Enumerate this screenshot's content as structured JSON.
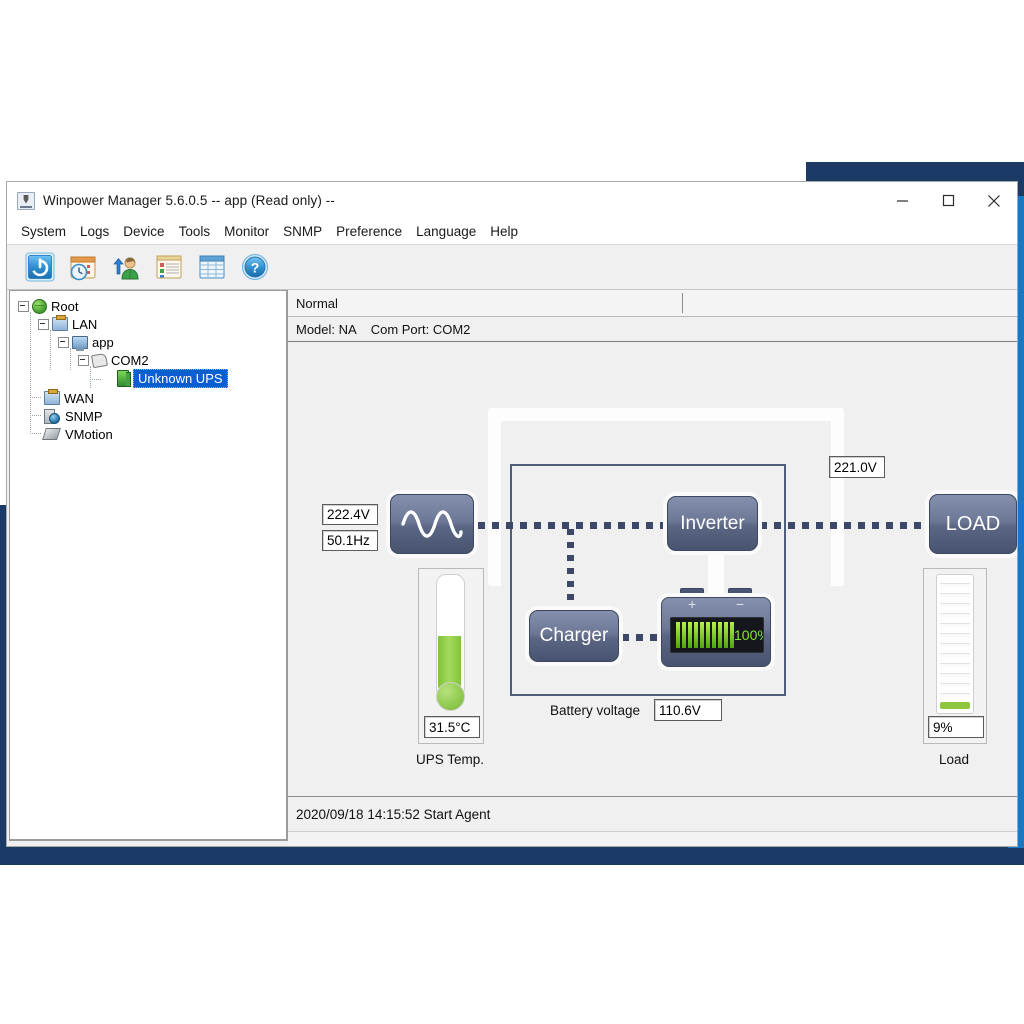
{
  "window": {
    "title": "Winpower Manager 5.6.0.5 -- app (Read only) --",
    "app_icon": "java-cup-icon",
    "minimize_label": "–",
    "maximize_label": "☐",
    "close_label": "✕"
  },
  "menubar": {
    "items": [
      {
        "label": "System"
      },
      {
        "label": "Logs"
      },
      {
        "label": "Device"
      },
      {
        "label": "Tools"
      },
      {
        "label": "Monitor"
      },
      {
        "label": "SNMP"
      },
      {
        "label": "Preference"
      },
      {
        "label": "Language"
      },
      {
        "label": "Help"
      }
    ]
  },
  "toolbar": {
    "items": [
      {
        "name": "power-shutdown-icon"
      },
      {
        "name": "schedule-calendar-clock-icon"
      },
      {
        "name": "user-logon-icon"
      },
      {
        "name": "event-log-icon"
      },
      {
        "name": "data-table-icon"
      },
      {
        "name": "help-icon"
      }
    ]
  },
  "tree": {
    "nodes": [
      {
        "label": "Root",
        "icon": "globe-icon",
        "depth": 0,
        "expanded": true,
        "selected": false
      },
      {
        "label": "LAN",
        "icon": "network-icon",
        "depth": 1,
        "expanded": true,
        "selected": false
      },
      {
        "label": "app",
        "icon": "computer-icon",
        "depth": 2,
        "expanded": true,
        "selected": false
      },
      {
        "label": "COM2",
        "icon": "serial-port-icon",
        "depth": 3,
        "expanded": true,
        "selected": false
      },
      {
        "label": "Unknown UPS",
        "icon": "ups-device-icon",
        "depth": 4,
        "expanded": false,
        "selected": true
      },
      {
        "label": "WAN",
        "icon": "network-icon",
        "depth": 1,
        "expanded": false,
        "selected": false
      },
      {
        "label": "SNMP",
        "icon": "snmp-icon",
        "depth": 1,
        "expanded": false,
        "selected": false
      },
      {
        "label": "VMotion",
        "icon": "vmotion-icon",
        "depth": 1,
        "expanded": false,
        "selected": false
      }
    ]
  },
  "status": {
    "state": "Normal",
    "model_label": "Model: NA",
    "com_port_label": "Com Port: COM2"
  },
  "diagram": {
    "input_voltage": "222.4V",
    "input_frequency": "50.1Hz",
    "output_voltage": "221.0V",
    "inverter_label": "Inverter",
    "charger_label": "Charger",
    "load_label": "LOAD",
    "battery_percent_text": "100%",
    "battery_percent": 100,
    "battery_plus": "+",
    "battery_minus": "−",
    "battery_voltage_label": "Battery voltage",
    "battery_voltage_value": "110.6V",
    "ups_temp_value": "31.5°C",
    "ups_temp_caption": "UPS Temp.",
    "ups_temp_fill_pct": 33,
    "load_value": "9%",
    "load_caption": "Load",
    "load_fill_pct": 9
  },
  "log": {
    "entry": "2020/09/18 14:15:52  Start Agent"
  },
  "colors": {
    "accent_blue": "#0a5fd0",
    "module_blue": "#5a6683",
    "battery_green": "#7ee63a",
    "load_green": "#8ec63f",
    "desktop_navy": "#1b3a66",
    "desktop_blue": "#1878c8"
  }
}
